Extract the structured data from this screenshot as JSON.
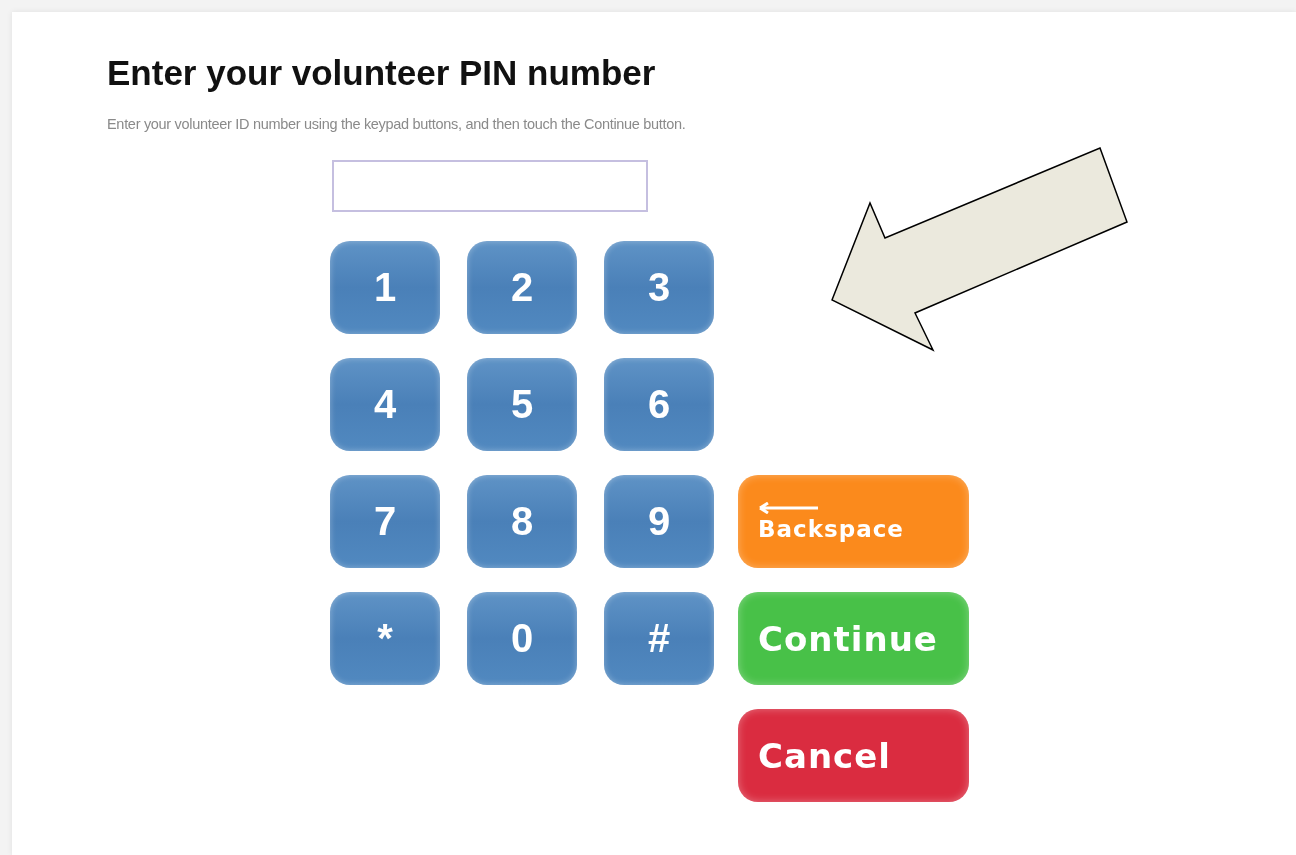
{
  "title": "Enter your volunteer PIN number",
  "instructions": "Enter your volunteer ID number using the keypad buttons, and then touch the Continue button.",
  "keys": [
    "1",
    "2",
    "3",
    "4",
    "5",
    "6",
    "7",
    "8",
    "9",
    "*",
    "0",
    "#"
  ],
  "actions": [
    {
      "kind": "backspace",
      "label": "Backspace"
    },
    {
      "kind": "continue",
      "label": "Continue"
    },
    {
      "kind": "cancel",
      "label": "Cancel"
    }
  ]
}
